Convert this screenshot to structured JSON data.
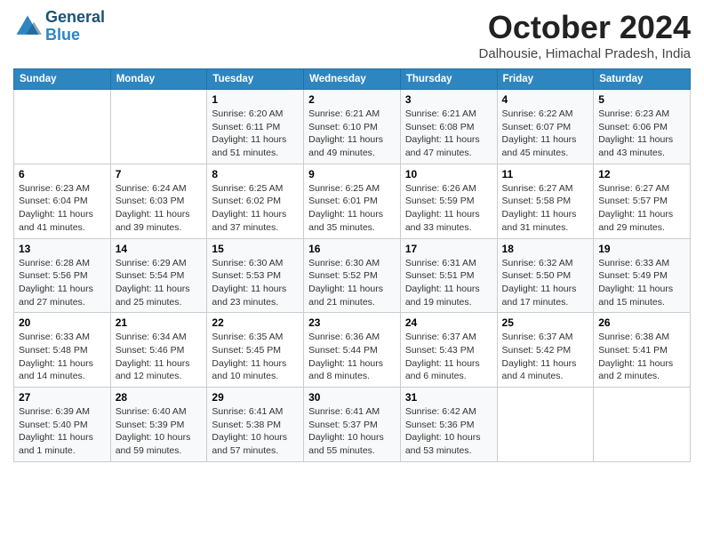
{
  "header": {
    "logo_line1": "General",
    "logo_line2": "Blue",
    "month": "October 2024",
    "location": "Dalhousie, Himachal Pradesh, India"
  },
  "days_of_week": [
    "Sunday",
    "Monday",
    "Tuesday",
    "Wednesday",
    "Thursday",
    "Friday",
    "Saturday"
  ],
  "weeks": [
    [
      {
        "day": "",
        "info": ""
      },
      {
        "day": "",
        "info": ""
      },
      {
        "day": "1",
        "info": "Sunrise: 6:20 AM\nSunset: 6:11 PM\nDaylight: 11 hours\nand 51 minutes."
      },
      {
        "day": "2",
        "info": "Sunrise: 6:21 AM\nSunset: 6:10 PM\nDaylight: 11 hours\nand 49 minutes."
      },
      {
        "day": "3",
        "info": "Sunrise: 6:21 AM\nSunset: 6:08 PM\nDaylight: 11 hours\nand 47 minutes."
      },
      {
        "day": "4",
        "info": "Sunrise: 6:22 AM\nSunset: 6:07 PM\nDaylight: 11 hours\nand 45 minutes."
      },
      {
        "day": "5",
        "info": "Sunrise: 6:23 AM\nSunset: 6:06 PM\nDaylight: 11 hours\nand 43 minutes."
      }
    ],
    [
      {
        "day": "6",
        "info": "Sunrise: 6:23 AM\nSunset: 6:04 PM\nDaylight: 11 hours\nand 41 minutes."
      },
      {
        "day": "7",
        "info": "Sunrise: 6:24 AM\nSunset: 6:03 PM\nDaylight: 11 hours\nand 39 minutes."
      },
      {
        "day": "8",
        "info": "Sunrise: 6:25 AM\nSunset: 6:02 PM\nDaylight: 11 hours\nand 37 minutes."
      },
      {
        "day": "9",
        "info": "Sunrise: 6:25 AM\nSunset: 6:01 PM\nDaylight: 11 hours\nand 35 minutes."
      },
      {
        "day": "10",
        "info": "Sunrise: 6:26 AM\nSunset: 5:59 PM\nDaylight: 11 hours\nand 33 minutes."
      },
      {
        "day": "11",
        "info": "Sunrise: 6:27 AM\nSunset: 5:58 PM\nDaylight: 11 hours\nand 31 minutes."
      },
      {
        "day": "12",
        "info": "Sunrise: 6:27 AM\nSunset: 5:57 PM\nDaylight: 11 hours\nand 29 minutes."
      }
    ],
    [
      {
        "day": "13",
        "info": "Sunrise: 6:28 AM\nSunset: 5:56 PM\nDaylight: 11 hours\nand 27 minutes."
      },
      {
        "day": "14",
        "info": "Sunrise: 6:29 AM\nSunset: 5:54 PM\nDaylight: 11 hours\nand 25 minutes."
      },
      {
        "day": "15",
        "info": "Sunrise: 6:30 AM\nSunset: 5:53 PM\nDaylight: 11 hours\nand 23 minutes."
      },
      {
        "day": "16",
        "info": "Sunrise: 6:30 AM\nSunset: 5:52 PM\nDaylight: 11 hours\nand 21 minutes."
      },
      {
        "day": "17",
        "info": "Sunrise: 6:31 AM\nSunset: 5:51 PM\nDaylight: 11 hours\nand 19 minutes."
      },
      {
        "day": "18",
        "info": "Sunrise: 6:32 AM\nSunset: 5:50 PM\nDaylight: 11 hours\nand 17 minutes."
      },
      {
        "day": "19",
        "info": "Sunrise: 6:33 AM\nSunset: 5:49 PM\nDaylight: 11 hours\nand 15 minutes."
      }
    ],
    [
      {
        "day": "20",
        "info": "Sunrise: 6:33 AM\nSunset: 5:48 PM\nDaylight: 11 hours\nand 14 minutes."
      },
      {
        "day": "21",
        "info": "Sunrise: 6:34 AM\nSunset: 5:46 PM\nDaylight: 11 hours\nand 12 minutes."
      },
      {
        "day": "22",
        "info": "Sunrise: 6:35 AM\nSunset: 5:45 PM\nDaylight: 11 hours\nand 10 minutes."
      },
      {
        "day": "23",
        "info": "Sunrise: 6:36 AM\nSunset: 5:44 PM\nDaylight: 11 hours\nand 8 minutes."
      },
      {
        "day": "24",
        "info": "Sunrise: 6:37 AM\nSunset: 5:43 PM\nDaylight: 11 hours\nand 6 minutes."
      },
      {
        "day": "25",
        "info": "Sunrise: 6:37 AM\nSunset: 5:42 PM\nDaylight: 11 hours\nand 4 minutes."
      },
      {
        "day": "26",
        "info": "Sunrise: 6:38 AM\nSunset: 5:41 PM\nDaylight: 11 hours\nand 2 minutes."
      }
    ],
    [
      {
        "day": "27",
        "info": "Sunrise: 6:39 AM\nSunset: 5:40 PM\nDaylight: 11 hours\nand 1 minute."
      },
      {
        "day": "28",
        "info": "Sunrise: 6:40 AM\nSunset: 5:39 PM\nDaylight: 10 hours\nand 59 minutes."
      },
      {
        "day": "29",
        "info": "Sunrise: 6:41 AM\nSunset: 5:38 PM\nDaylight: 10 hours\nand 57 minutes."
      },
      {
        "day": "30",
        "info": "Sunrise: 6:41 AM\nSunset: 5:37 PM\nDaylight: 10 hours\nand 55 minutes."
      },
      {
        "day": "31",
        "info": "Sunrise: 6:42 AM\nSunset: 5:36 PM\nDaylight: 10 hours\nand 53 minutes."
      },
      {
        "day": "",
        "info": ""
      },
      {
        "day": "",
        "info": ""
      }
    ]
  ]
}
